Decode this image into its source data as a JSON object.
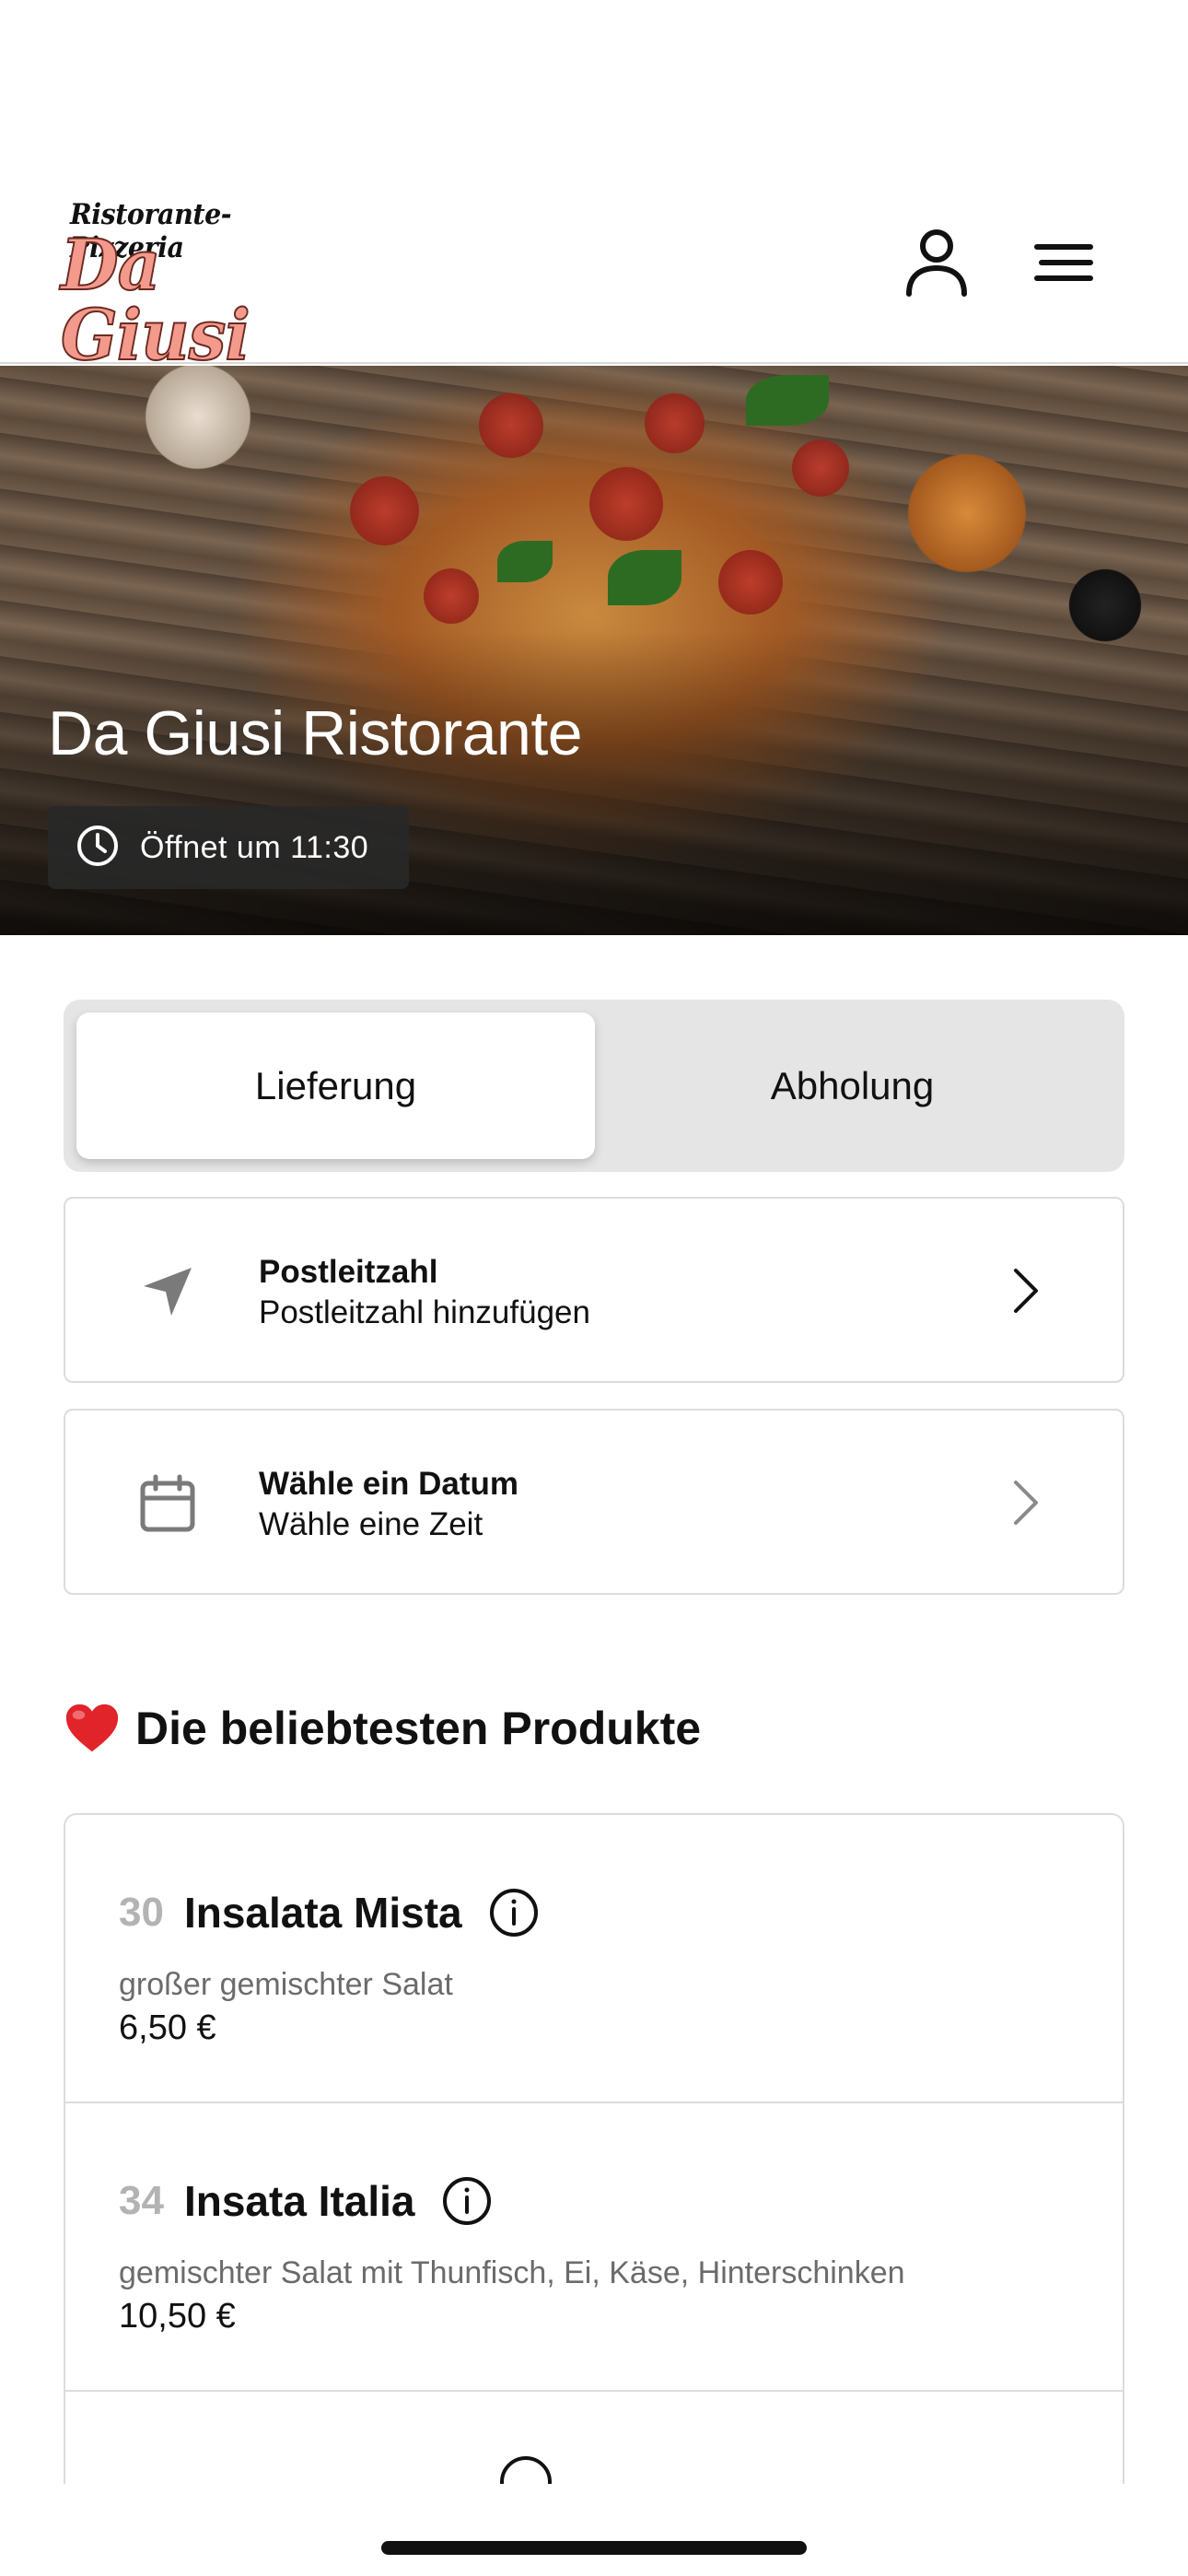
{
  "header": {
    "logo_top": "Ristorante-Pizzeria",
    "logo_main": "Da Giusi",
    "icons": [
      "user-icon",
      "menu-icon"
    ]
  },
  "hero": {
    "title": "Da Giusi Ristorante",
    "opening_status": "Öffnet um 11:30",
    "status_icon": "clock-icon"
  },
  "order_mode": {
    "options": [
      "Lieferung",
      "Abholung"
    ],
    "selected": "Lieferung"
  },
  "postcode_card": {
    "icon": "location-arrow-icon",
    "title": "Postleitzahl",
    "subtitle": "Postleitzahl hinzufügen"
  },
  "date_card": {
    "icon": "calendar-icon",
    "title": "Wähle ein Datum",
    "subtitle": "Wähle eine Zeit"
  },
  "popular": {
    "title": "Die beliebtesten Produkte",
    "icon": "heart-icon",
    "products": [
      {
        "number": "30",
        "name": "Insalata Mista",
        "description": "großer gemischter Salat",
        "price": "6,50 €"
      },
      {
        "number": "34",
        "name": "Insata Italia",
        "description": "gemischter Salat mit Thunfisch, Ei, Käse, Hinterschinken",
        "price": "10,50 €"
      }
    ]
  },
  "colors": {
    "logo_accent": "#f39a8c",
    "segment_bg": "#e5e5e5",
    "border": "#dcdcdc",
    "muted_number": "#b3b3b3"
  }
}
